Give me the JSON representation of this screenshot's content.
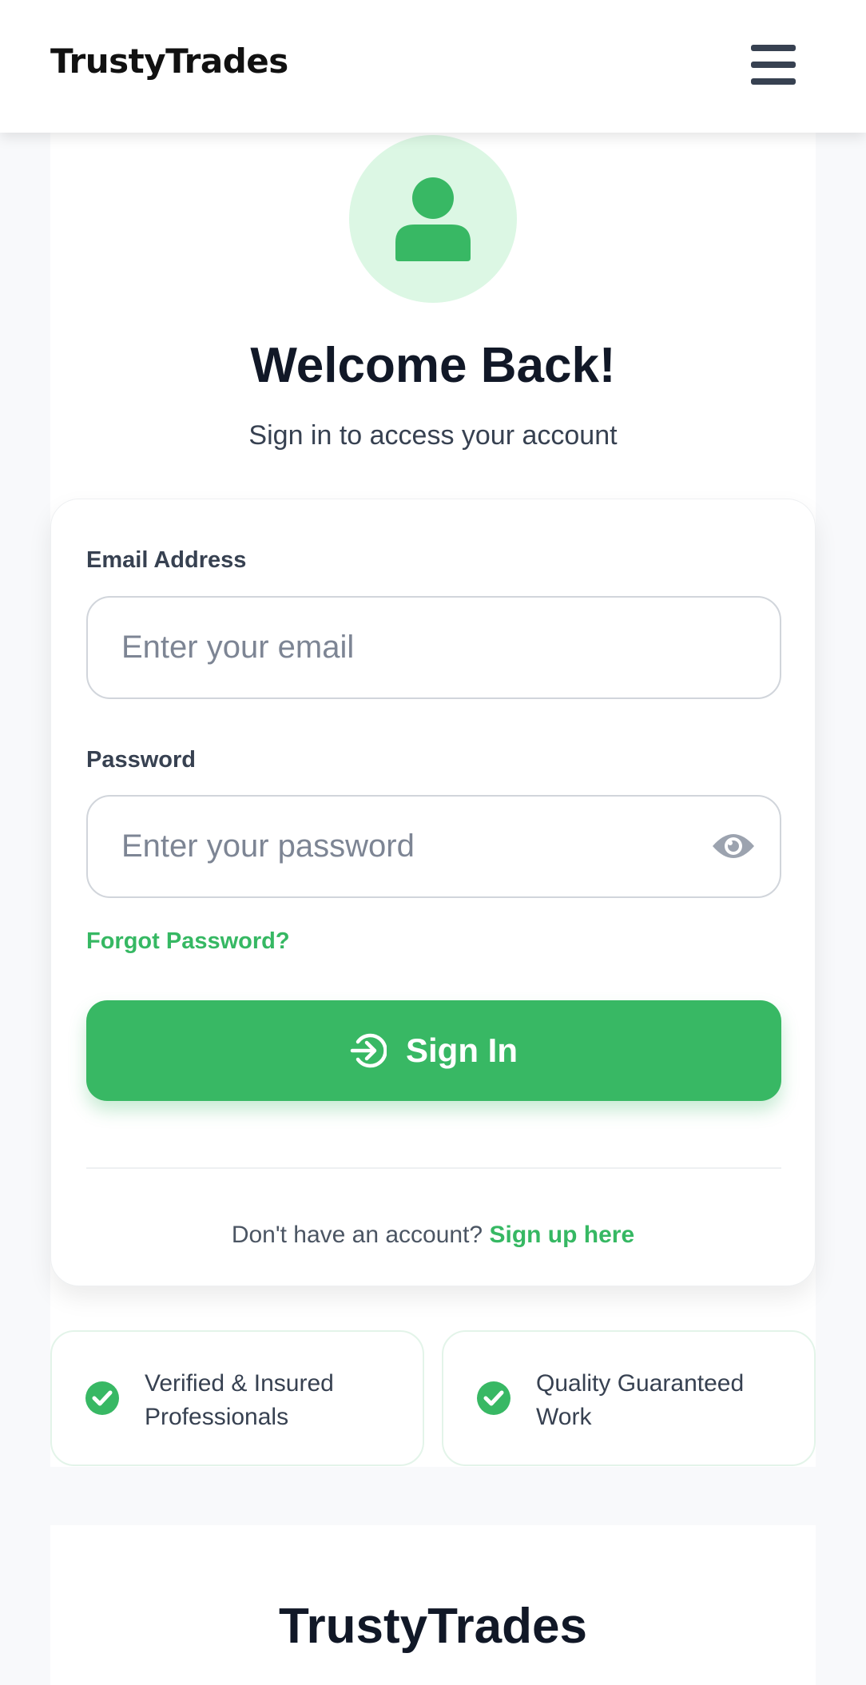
{
  "header": {
    "logo": "TrustyTrades",
    "menu_icon": "hamburger-menu-icon"
  },
  "hero": {
    "avatar_icon": "user-icon",
    "title": "Welcome Back!",
    "subtitle": "Sign in to access your account"
  },
  "form": {
    "email_label": "Email Address",
    "email_placeholder": "Enter your email",
    "email_value": "",
    "password_label": "Password",
    "password_placeholder": "Enter your password",
    "password_value": "",
    "password_toggle_icon": "eye-icon",
    "forgot_label": "Forgot Password?",
    "signin_icon": "sign-in-arrow-icon",
    "signin_label": "Sign In",
    "signup_prompt": "Don't have an account?",
    "signup_link": "Sign up here"
  },
  "features": [
    {
      "icon": "check-circle-icon",
      "text": "Verified & Insured Professionals"
    },
    {
      "icon": "check-circle-icon",
      "text": "Quality Guaranteed Work"
    }
  ],
  "footer": {
    "title": "TrustyTrades"
  },
  "colors": {
    "accent": "#38b864",
    "accent_light": "#dcf7e4",
    "heading": "#111827",
    "body_text": "#374151",
    "background": "#f8f9fb"
  }
}
